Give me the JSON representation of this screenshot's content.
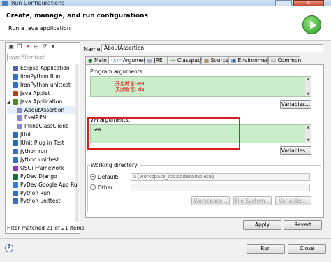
{
  "window": {
    "title": "Run Configurations",
    "minimize_glyph": "–",
    "close_glyph": "x"
  },
  "header": {
    "title": "Create, manage, and run configurations",
    "subtitle": "Run a Java application",
    "icon": "run-icon"
  },
  "left_pane": {
    "filter_placeholder": "type filter text",
    "toolbar_icons": [
      "new-config-icon",
      "duplicate-icon",
      "delete-icon",
      "collapse-all-icon",
      "filter-icon",
      "dropdown-arrow-icon"
    ],
    "tree": [
      {
        "label": "Eclipse Application",
        "icon": "eclipse-icon",
        "level": 0,
        "color": "#5b5fa8"
      },
      {
        "label": "IronPython Run",
        "icon": "python-icon",
        "level": 0,
        "color": "#3b6fb5"
      },
      {
        "label": "IronPython unittest",
        "icon": "python-test-icon",
        "level": 0,
        "color": "#3b6fb5"
      },
      {
        "label": "Java Applet",
        "icon": "java-applet-icon",
        "level": 0,
        "color": "#b04020"
      },
      {
        "label": "Java Application",
        "icon": "java-app-icon",
        "level": 0,
        "color": "#4a8a2a",
        "expanded": true
      },
      {
        "label": "AboutAssertion",
        "icon": "java-class-icon",
        "level": 1,
        "color": "#8a8acb",
        "selected": true
      },
      {
        "label": "EvalRPN",
        "icon": "java-class-icon",
        "level": 1,
        "color": "#8a8acb"
      },
      {
        "label": "InlineClassClient",
        "icon": "java-class-icon",
        "level": 1,
        "color": "#8a8acb"
      },
      {
        "label": "JUnit",
        "icon": "junit-icon",
        "level": 0,
        "color": "#2a6ab0"
      },
      {
        "label": "JUnit Plug-in Test",
        "icon": "junit-plugin-icon",
        "level": 0,
        "color": "#2a6ab0"
      },
      {
        "label": "Jython run",
        "icon": "jython-icon",
        "level": 0,
        "color": "#3b6fb5"
      },
      {
        "label": "Jython unittest",
        "icon": "jython-test-icon",
        "level": 0,
        "color": "#3b6fb5"
      },
      {
        "label": "OSGi Framework",
        "icon": "osgi-icon",
        "level": 0,
        "color": "#8a3ab0"
      },
      {
        "label": "PyDev Django",
        "icon": "django-icon",
        "level": 0,
        "color": "#1a6a3a"
      },
      {
        "label": "PyDev Google App Ru",
        "icon": "google-app-icon",
        "level": 0,
        "color": "#3a7ad0"
      },
      {
        "label": "Python Run",
        "icon": "python-icon",
        "level": 0,
        "color": "#3b6fb5"
      },
      {
        "label": "Python unittest",
        "icon": "python-test-icon",
        "level": 0,
        "color": "#3b6fb5"
      }
    ],
    "status": "Filter matched 21 of 21 items"
  },
  "config": {
    "name_label": "Name:",
    "name_value": "AboutAssertion",
    "tabs": [
      {
        "label": "Main",
        "icon": "main-tab-icon"
      },
      {
        "label": "Arguments",
        "icon": "arguments-tab-icon",
        "active": true
      },
      {
        "label": "JRE",
        "icon": "jre-tab-icon"
      },
      {
        "label": "Classpath",
        "icon": "classpath-tab-icon"
      },
      {
        "label": "Source",
        "icon": "source-tab-icon"
      },
      {
        "label": "Environment",
        "icon": "environment-tab-icon"
      },
      {
        "label": "Common",
        "icon": "common-tab-icon"
      }
    ],
    "program_args_label": "Program arguments:",
    "program_args_annotation": [
      "开启断言:-ea",
      "关闭断言:-da"
    ],
    "variables_label": "Variables...",
    "vm_args_label": "VM arguments:",
    "vm_args_value": "-ea",
    "working_dir_label": "Working directory:",
    "default_label": "Default:",
    "default_value": "${workspace_loc:codecomplete}",
    "other_label": "Other:",
    "workspace_btn": "Workspace...",
    "filesystem_btn": "File System...",
    "variables_btn": "Variables...",
    "apply_btn": "Apply",
    "revert_btn": "Revert"
  },
  "footer": {
    "help_glyph": "?",
    "run_btn": "Run",
    "close_btn": "Close"
  },
  "colors": {
    "highlight_green": "#c9ecc9",
    "annotation_red": "#d42020"
  }
}
